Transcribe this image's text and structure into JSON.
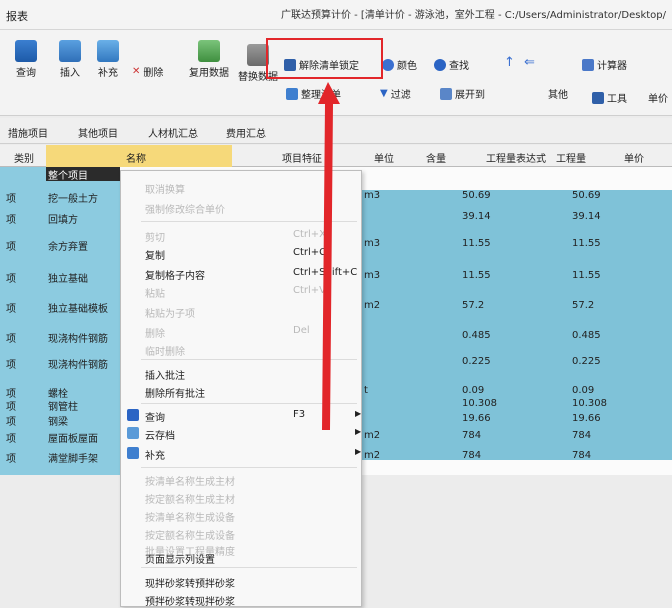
{
  "window": {
    "title": "报表",
    "path_title": "广联达预算计价 - [清单计价 - 游泳池，室外工程 - C:/Users/Administrator/Desktop/"
  },
  "ribbon": {
    "query": "查询",
    "insert": "插入",
    "supplement": "补充",
    "delete": "删除",
    "reuse_data": "复用数据",
    "replace_data": "替换数据",
    "unlock_list": "解除清单锁定",
    "color": "颜色",
    "find": "查找",
    "calculator": "计算器",
    "filter": "过滤",
    "expand_to": "展开到",
    "other": "其他",
    "tools": "工具",
    "unit_price": "单价",
    "sort_list": "整理清单"
  },
  "tabs": [
    "措施项目",
    "其他项目",
    "人材机汇总",
    "费用汇总"
  ],
  "table": {
    "headers": {
      "category": "类别",
      "name": "名称",
      "item_feature": "项目特征",
      "unit": "单位",
      "content": "含量",
      "qty_expr": "工程量表达式",
      "qty": "工程量",
      "unit_price": "单价"
    },
    "current_cell": "整个项目",
    "rows": [
      {
        "cat": "项",
        "name": "挖一般土方",
        "unit": "m3",
        "expr": "50.69",
        "qty": "50.69"
      },
      {
        "cat": "项",
        "name": "回填方",
        "unit": "",
        "expr": "39.14",
        "qty": "39.14"
      },
      {
        "cat": "项",
        "name": "余方弃置",
        "unit": "m3",
        "expr": "11.55",
        "qty": "11.55"
      },
      {
        "cat": "项",
        "name": "独立基础",
        "unit": "m3",
        "expr": "11.55",
        "qty": "11.55"
      },
      {
        "cat": "项",
        "name": "独立基础模板",
        "unit": "m2",
        "expr": "57.2",
        "qty": "57.2"
      },
      {
        "cat": "项",
        "name": "现浇构件钢筋",
        "unit": "",
        "expr": "0.485",
        "qty": "0.485"
      },
      {
        "cat": "项",
        "name": "现浇构件钢筋",
        "unit": "",
        "expr": "0.225",
        "qty": "0.225"
      },
      {
        "cat": "项",
        "name": "螺栓",
        "unit": "t",
        "expr": "0.09",
        "qty": "0.09"
      },
      {
        "cat": "项",
        "name": "钢管柱",
        "unit": "",
        "expr": "10.308",
        "qty": "10.308"
      },
      {
        "cat": "项",
        "name": "钢梁",
        "unit": "",
        "expr": "19.66",
        "qty": "19.66"
      },
      {
        "cat": "项",
        "name": "屋面板屋面",
        "unit": "m2",
        "expr": "784",
        "qty": "784"
      },
      {
        "cat": "项",
        "name": "满堂脚手架",
        "unit": "m2",
        "expr": "784",
        "qty": "784"
      }
    ]
  },
  "context_menu": {
    "items": [
      {
        "label": "取消换算",
        "shortcut": "",
        "disabled": true
      },
      {
        "label": "强制修改综合单价",
        "shortcut": "",
        "disabled": true
      },
      {
        "label": "剪切",
        "shortcut": "Ctrl+X",
        "disabled": true
      },
      {
        "label": "复制",
        "shortcut": "Ctrl+C",
        "disabled": false
      },
      {
        "label": "复制格子内容",
        "shortcut": "Ctrl+Shift+C",
        "disabled": false
      },
      {
        "label": "粘贴",
        "shortcut": "Ctrl+V",
        "disabled": true
      },
      {
        "label": "粘贴为子项",
        "shortcut": "",
        "disabled": true
      },
      {
        "label": "删除",
        "shortcut": "Del",
        "disabled": true
      },
      {
        "label": "临时删除",
        "shortcut": "",
        "disabled": true
      },
      {
        "label": "插入批注",
        "shortcut": "",
        "disabled": false
      },
      {
        "label": "删除所有批注",
        "shortcut": "",
        "disabled": false
      },
      {
        "label": "查询",
        "shortcut": "F3",
        "disabled": false
      },
      {
        "label": "云存档",
        "shortcut": "",
        "disabled": false
      },
      {
        "label": "补充",
        "shortcut": "",
        "disabled": false
      },
      {
        "label": "按清单名称生成主材",
        "shortcut": "",
        "disabled": true
      },
      {
        "label": "按定额名称生成主材",
        "shortcut": "",
        "disabled": true
      },
      {
        "label": "按清单名称生成设备",
        "shortcut": "",
        "disabled": true
      },
      {
        "label": "按定额名称生成设备",
        "shortcut": "",
        "disabled": true
      },
      {
        "label": "批量设置工程量精度",
        "shortcut": "",
        "disabled": true
      },
      {
        "label": "页面显示列设置",
        "shortcut": "",
        "disabled": false
      },
      {
        "label": "现拌砂浆转预拌砂浆",
        "shortcut": "",
        "disabled": false
      },
      {
        "label": "预拌砂浆转现拌砂浆",
        "shortcut": "",
        "disabled": false
      }
    ]
  },
  "colors": {
    "highlight_box": "#e2262a",
    "selection": "#7fc6dc",
    "name_header": "#f6d97a"
  }
}
